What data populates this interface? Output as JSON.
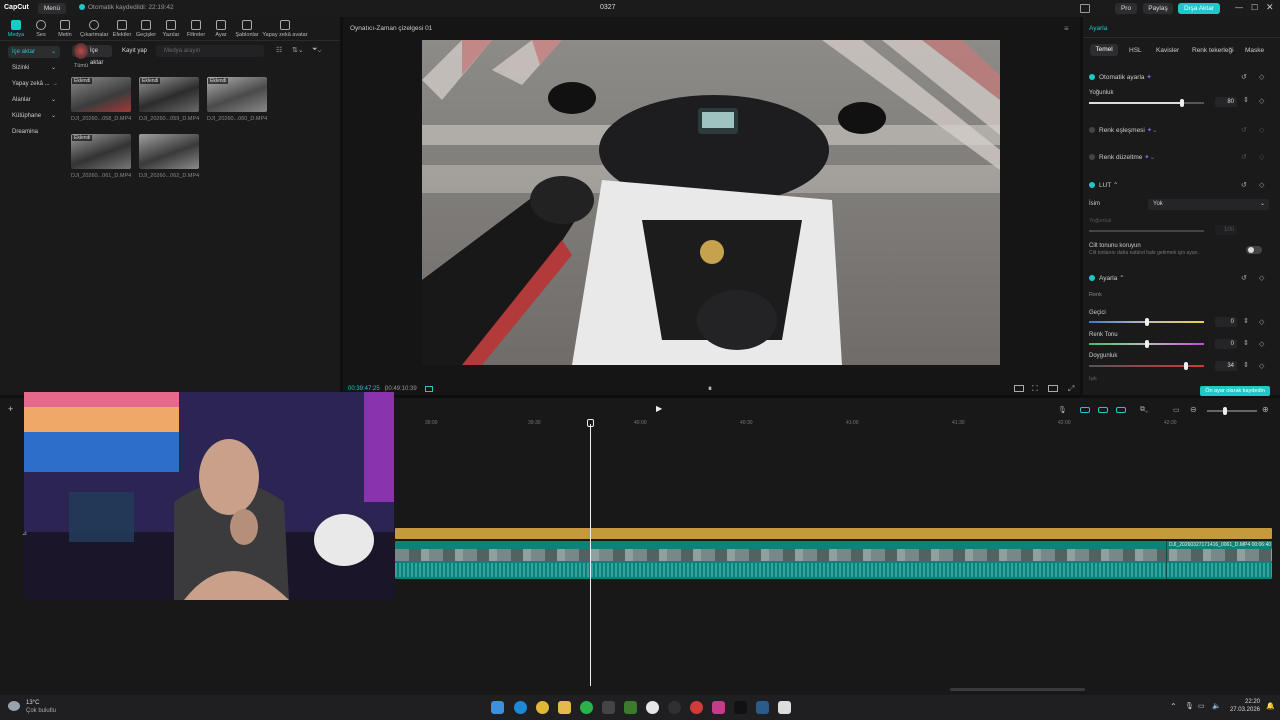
{
  "titlebar": {
    "logo": "CapCut",
    "menu": "Menü",
    "autosave": "Otomatik kaydedildi: 22:19:42",
    "project": "0327",
    "pro": "Pro",
    "share": "Paylaş",
    "export": "Dışa Aktar"
  },
  "toolbar": [
    {
      "label": "Medya",
      "icon": "media-icon"
    },
    {
      "label": "Ses",
      "icon": "audio-icon"
    },
    {
      "label": "Metin",
      "icon": "text-icon"
    },
    {
      "label": "Çıkartmalar",
      "icon": "sticker-icon"
    },
    {
      "label": "Efektler",
      "icon": "effects-icon"
    },
    {
      "label": "Geçişler",
      "icon": "transitions-icon"
    },
    {
      "label": "Yazılar",
      "icon": "captions-icon"
    },
    {
      "label": "Filtreler",
      "icon": "filters-icon"
    },
    {
      "label": "Ayar",
      "icon": "adjust-icon"
    },
    {
      "label": "Şablonlar",
      "icon": "templates-icon"
    },
    {
      "label": "Yapay zekâ avatar",
      "icon": "ai-avatar-icon"
    }
  ],
  "sidebar": [
    {
      "label": "İçe aktar"
    },
    {
      "label": "Sizinki"
    },
    {
      "label": "Yapay zekâ ..."
    },
    {
      "label": "Alanlar"
    },
    {
      "label": "Kütüphane"
    },
    {
      "label": "Dreamina"
    }
  ],
  "media": {
    "import_label": "İçe aktar",
    "record_label": "Kayıt yap",
    "search_placeholder": "Medya arayın",
    "filter_all": "Tümü",
    "items": [
      {
        "badge": "Eklendi",
        "name": "DJI_20260...058_D.MP4"
      },
      {
        "badge": "Eklendi",
        "name": "DJI_20260...059_D.MP4"
      },
      {
        "badge": "Eklendi",
        "name": "DJI_20260...060_D.MP4"
      },
      {
        "badge": "Eklendi",
        "name": "DJI_20260...061_D.MP4"
      },
      {
        "badge": "",
        "name": "DJI_20260...062_D.MP4"
      }
    ]
  },
  "player": {
    "title": "Oynatıcı-Zaman çizelgesi 01",
    "current_time": "00:39:47:25",
    "total_time": "00:49:10:39"
  },
  "rightpanel": {
    "title": "Ayarla",
    "tabs": [
      "Temel",
      "HSL",
      "Kavisler",
      "Renk tekerleği",
      "Maske"
    ],
    "auto_adjust": "Otomatik ayarla",
    "intensity_label": "Yoğunluk",
    "intensity_value": "80",
    "color_match": "Renk eşleşmesi",
    "color_correction": "Renk düzeltme",
    "lut": "LUT",
    "name_label": "İsim",
    "name_value": "Yok",
    "lut_intensity": "Yoğunluk",
    "lut_intensity_value": "100",
    "skin_protect": "Cilt tonunu koruyun",
    "skin_protect_desc": "Cilt tonlarını daha natürel hale getirmek için ayarı.",
    "adjust_section": "Ayarla",
    "color_label": "Renk",
    "temp_label": "Geçici",
    "temp_value": "0",
    "tint_label": "Renk Tonu",
    "tint_value": "0",
    "saturation_label": "Doygunluk",
    "saturation_value": "34",
    "light_label": "Işık",
    "save_preset": "Ön ayar olarak kaydedin",
    "accent": "#1ec8c8"
  },
  "timeline": {
    "ticks": [
      "39:00",
      "39:30",
      "40:00",
      "40:30",
      "41:00",
      "41:30",
      "42:00",
      "42:30"
    ],
    "clip_label": "DJI_20260327171416_0061_D.MP4",
    "clip_duration": "00:06:40"
  },
  "taskbar": {
    "weather_temp": "13°C",
    "weather_desc": "Çok bulutlu",
    "time": "22:20",
    "date": "27.03.2026"
  }
}
